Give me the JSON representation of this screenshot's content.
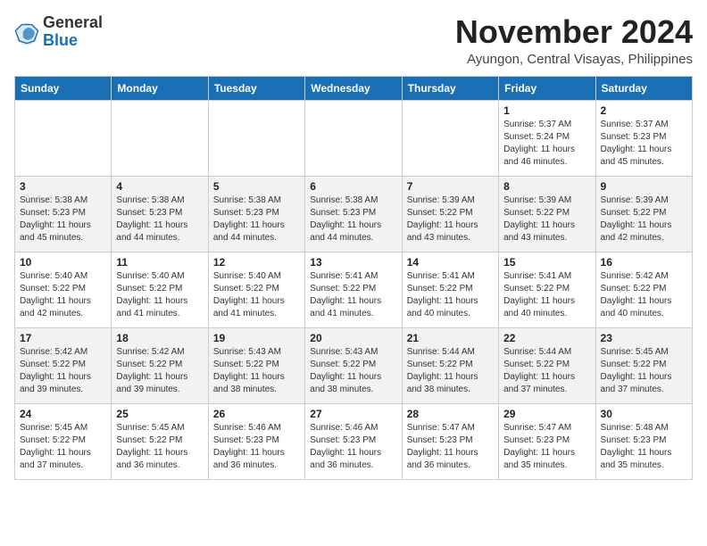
{
  "header": {
    "logo_general": "General",
    "logo_blue": "Blue",
    "month": "November 2024",
    "location": "Ayungon, Central Visayas, Philippines"
  },
  "weekdays": [
    "Sunday",
    "Monday",
    "Tuesday",
    "Wednesday",
    "Thursday",
    "Friday",
    "Saturday"
  ],
  "weeks": [
    [
      {
        "day": "",
        "info": ""
      },
      {
        "day": "",
        "info": ""
      },
      {
        "day": "",
        "info": ""
      },
      {
        "day": "",
        "info": ""
      },
      {
        "day": "",
        "info": ""
      },
      {
        "day": "1",
        "info": "Sunrise: 5:37 AM\nSunset: 5:24 PM\nDaylight: 11 hours and 46 minutes."
      },
      {
        "day": "2",
        "info": "Sunrise: 5:37 AM\nSunset: 5:23 PM\nDaylight: 11 hours and 45 minutes."
      }
    ],
    [
      {
        "day": "3",
        "info": "Sunrise: 5:38 AM\nSunset: 5:23 PM\nDaylight: 11 hours and 45 minutes."
      },
      {
        "day": "4",
        "info": "Sunrise: 5:38 AM\nSunset: 5:23 PM\nDaylight: 11 hours and 44 minutes."
      },
      {
        "day": "5",
        "info": "Sunrise: 5:38 AM\nSunset: 5:23 PM\nDaylight: 11 hours and 44 minutes."
      },
      {
        "day": "6",
        "info": "Sunrise: 5:38 AM\nSunset: 5:23 PM\nDaylight: 11 hours and 44 minutes."
      },
      {
        "day": "7",
        "info": "Sunrise: 5:39 AM\nSunset: 5:22 PM\nDaylight: 11 hours and 43 minutes."
      },
      {
        "day": "8",
        "info": "Sunrise: 5:39 AM\nSunset: 5:22 PM\nDaylight: 11 hours and 43 minutes."
      },
      {
        "day": "9",
        "info": "Sunrise: 5:39 AM\nSunset: 5:22 PM\nDaylight: 11 hours and 42 minutes."
      }
    ],
    [
      {
        "day": "10",
        "info": "Sunrise: 5:40 AM\nSunset: 5:22 PM\nDaylight: 11 hours and 42 minutes."
      },
      {
        "day": "11",
        "info": "Sunrise: 5:40 AM\nSunset: 5:22 PM\nDaylight: 11 hours and 41 minutes."
      },
      {
        "day": "12",
        "info": "Sunrise: 5:40 AM\nSunset: 5:22 PM\nDaylight: 11 hours and 41 minutes."
      },
      {
        "day": "13",
        "info": "Sunrise: 5:41 AM\nSunset: 5:22 PM\nDaylight: 11 hours and 41 minutes."
      },
      {
        "day": "14",
        "info": "Sunrise: 5:41 AM\nSunset: 5:22 PM\nDaylight: 11 hours and 40 minutes."
      },
      {
        "day": "15",
        "info": "Sunrise: 5:41 AM\nSunset: 5:22 PM\nDaylight: 11 hours and 40 minutes."
      },
      {
        "day": "16",
        "info": "Sunrise: 5:42 AM\nSunset: 5:22 PM\nDaylight: 11 hours and 40 minutes."
      }
    ],
    [
      {
        "day": "17",
        "info": "Sunrise: 5:42 AM\nSunset: 5:22 PM\nDaylight: 11 hours and 39 minutes."
      },
      {
        "day": "18",
        "info": "Sunrise: 5:42 AM\nSunset: 5:22 PM\nDaylight: 11 hours and 39 minutes."
      },
      {
        "day": "19",
        "info": "Sunrise: 5:43 AM\nSunset: 5:22 PM\nDaylight: 11 hours and 38 minutes."
      },
      {
        "day": "20",
        "info": "Sunrise: 5:43 AM\nSunset: 5:22 PM\nDaylight: 11 hours and 38 minutes."
      },
      {
        "day": "21",
        "info": "Sunrise: 5:44 AM\nSunset: 5:22 PM\nDaylight: 11 hours and 38 minutes."
      },
      {
        "day": "22",
        "info": "Sunrise: 5:44 AM\nSunset: 5:22 PM\nDaylight: 11 hours and 37 minutes."
      },
      {
        "day": "23",
        "info": "Sunrise: 5:45 AM\nSunset: 5:22 PM\nDaylight: 11 hours and 37 minutes."
      }
    ],
    [
      {
        "day": "24",
        "info": "Sunrise: 5:45 AM\nSunset: 5:22 PM\nDaylight: 11 hours and 37 minutes."
      },
      {
        "day": "25",
        "info": "Sunrise: 5:45 AM\nSunset: 5:22 PM\nDaylight: 11 hours and 36 minutes."
      },
      {
        "day": "26",
        "info": "Sunrise: 5:46 AM\nSunset: 5:23 PM\nDaylight: 11 hours and 36 minutes."
      },
      {
        "day": "27",
        "info": "Sunrise: 5:46 AM\nSunset: 5:23 PM\nDaylight: 11 hours and 36 minutes."
      },
      {
        "day": "28",
        "info": "Sunrise: 5:47 AM\nSunset: 5:23 PM\nDaylight: 11 hours and 36 minutes."
      },
      {
        "day": "29",
        "info": "Sunrise: 5:47 AM\nSunset: 5:23 PM\nDaylight: 11 hours and 35 minutes."
      },
      {
        "day": "30",
        "info": "Sunrise: 5:48 AM\nSunset: 5:23 PM\nDaylight: 11 hours and 35 minutes."
      }
    ]
  ]
}
